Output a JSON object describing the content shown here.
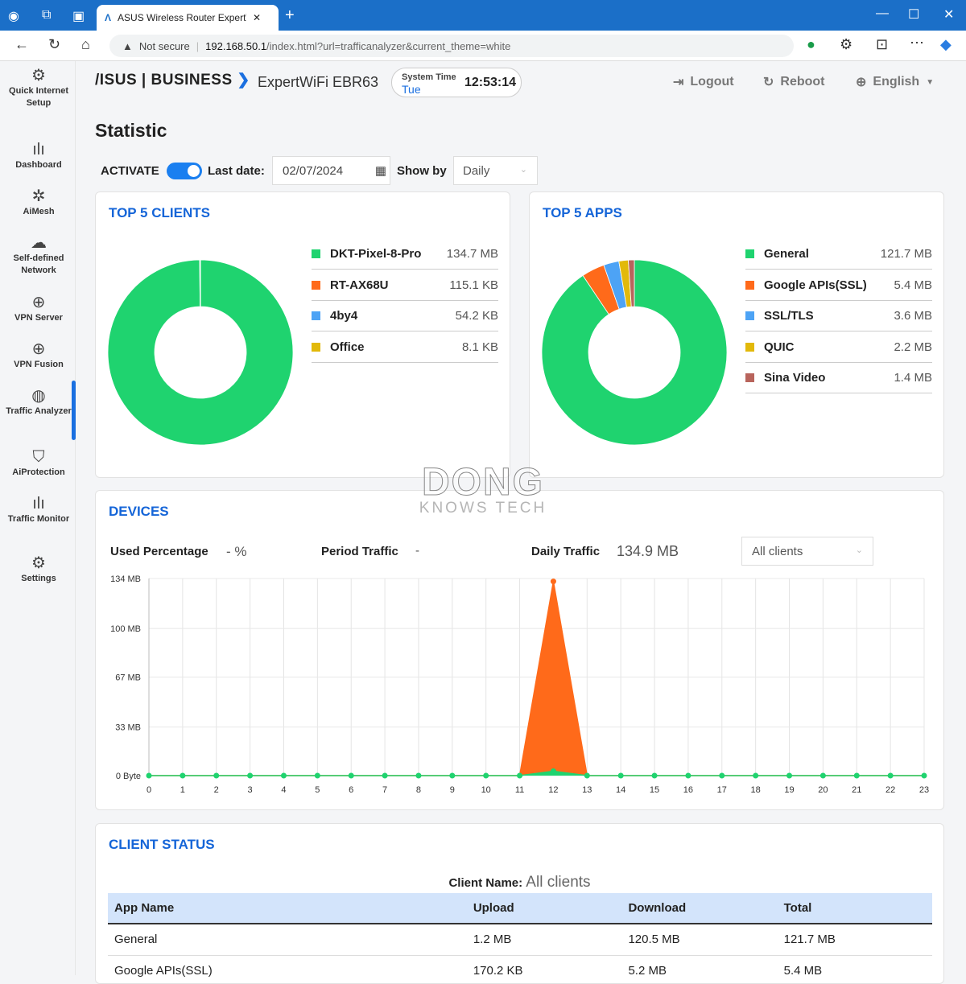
{
  "browser": {
    "tab_title": "ASUS Wireless Router ExpertWiFi",
    "not_secure": "Not secure",
    "url_host": "192.168.50.1",
    "url_path": "/index.html?url=trafficanalyzer&current_theme=white"
  },
  "header": {
    "brand": "/ISUS | BUSINESS",
    "model": "ExpertWiFi EBR63",
    "system_time_label": "System Time",
    "day": "Tue",
    "time": "12:53:14",
    "logout": "Logout",
    "reboot": "Reboot",
    "language": "English"
  },
  "sidebar": {
    "items": [
      {
        "label": "Quick Internet Setup",
        "icon": "gear-router-icon"
      },
      {
        "label": "Dashboard",
        "icon": "bar-chart-icon"
      },
      {
        "label": "AiMesh",
        "icon": "mesh-icon"
      },
      {
        "label": "Self-defined Network",
        "icon": "network-icon"
      },
      {
        "label": "VPN Server",
        "icon": "globe-icon"
      },
      {
        "label": "VPN Fusion",
        "icon": "globe-icon"
      },
      {
        "label": "Traffic Analyzer",
        "icon": "analyzer-icon",
        "active": true
      },
      {
        "label": "AiProtection",
        "icon": "shield-icon"
      },
      {
        "label": "Traffic Monitor",
        "icon": "bar-chart-icon"
      },
      {
        "label": "Settings",
        "icon": "gear-icon"
      }
    ]
  },
  "page": {
    "title": "Statistic",
    "activate": "ACTIVATE",
    "activated": true,
    "last_date_label": "Last date:",
    "last_date": "02/07/2024",
    "show_by_label": "Show by",
    "show_by": "Daily"
  },
  "colors": {
    "green": "#1fd36f",
    "orange": "#ff6a1a",
    "blue": "#4da3f5",
    "yellow": "#e2b90a",
    "brown": "#b8645c",
    "accent": "#1565d8"
  },
  "top_clients": {
    "title": "TOP 5 CLIENTS",
    "items": [
      {
        "name": "DKT-Pixel-8-Pro",
        "value": "134.7 MB",
        "bytes_mb": 134.7,
        "color": "#1fd36f"
      },
      {
        "name": "RT-AX68U",
        "value": "115.1 KB",
        "bytes_mb": 0.1151,
        "color": "#ff6a1a"
      },
      {
        "name": "4by4",
        "value": "54.2 KB",
        "bytes_mb": 0.0542,
        "color": "#4da3f5"
      },
      {
        "name": "Office",
        "value": "8.1 KB",
        "bytes_mb": 0.0081,
        "color": "#e2b90a"
      }
    ]
  },
  "top_apps": {
    "title": "TOP 5 APPS",
    "items": [
      {
        "name": "General",
        "value": "121.7 MB",
        "bytes_mb": 121.7,
        "color": "#1fd36f"
      },
      {
        "name": "Google APIs(SSL)",
        "value": "5.4 MB",
        "bytes_mb": 5.4,
        "color": "#ff6a1a"
      },
      {
        "name": "SSL/TLS",
        "value": "3.6 MB",
        "bytes_mb": 3.6,
        "color": "#4da3f5"
      },
      {
        "name": "QUIC",
        "value": "2.2 MB",
        "bytes_mb": 2.2,
        "color": "#e2b90a"
      },
      {
        "name": "Sina Video",
        "value": "1.4 MB",
        "bytes_mb": 1.4,
        "color": "#b8645c"
      }
    ]
  },
  "watermark": {
    "line1": "DONG",
    "line2": "KNOWS TECH"
  },
  "devices": {
    "title": "DEVICES",
    "used_pct_label": "Used Percentage",
    "used_pct": "- %",
    "period_label": "Period Traffic",
    "period": "-",
    "daily_label": "Daily Traffic",
    "daily": "134.9 MB",
    "filter": "All clients"
  },
  "chart_data": {
    "type": "area",
    "x": [
      0,
      1,
      2,
      3,
      4,
      5,
      6,
      7,
      8,
      9,
      10,
      11,
      12,
      13,
      14,
      15,
      16,
      17,
      18,
      19,
      20,
      21,
      22,
      23
    ],
    "ytick_labels": [
      "0 Byte",
      "33 MB",
      "67 MB",
      "100 MB",
      "134 MB"
    ],
    "yticks": [
      0,
      33,
      67,
      100,
      134
    ],
    "ylim": [
      0,
      134
    ],
    "grid": true,
    "series": [
      {
        "color": "#ff6a1a",
        "values": [
          0,
          0,
          0,
          0,
          0,
          0,
          0,
          0,
          0,
          0,
          0,
          0,
          132,
          0,
          0,
          0,
          0,
          0,
          0,
          0,
          0,
          0,
          0,
          0
        ]
      },
      {
        "color": "#1fd36f",
        "values": [
          0,
          0,
          0,
          0,
          0,
          0,
          0,
          0,
          0,
          0,
          0,
          0,
          3,
          0,
          0,
          0,
          0,
          0,
          0,
          0,
          0,
          0,
          0,
          0
        ]
      }
    ]
  },
  "client_status": {
    "title": "CLIENT STATUS",
    "client_name_label": "Client Name:",
    "client_name": "All clients",
    "columns": [
      "App Name",
      "Upload",
      "Download",
      "Total"
    ],
    "rows": [
      [
        "General",
        "1.2 MB",
        "120.5 MB",
        "121.7 MB"
      ],
      [
        "Google APIs(SSL)",
        "170.2 KB",
        "5.2 MB",
        "5.4 MB"
      ]
    ]
  }
}
